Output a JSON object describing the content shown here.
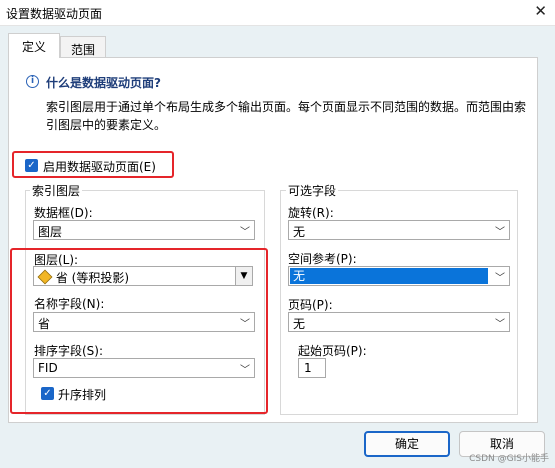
{
  "window": {
    "title": "设置数据驱动页面",
    "close_glyph": "✕"
  },
  "tabs": [
    {
      "label": "定义"
    },
    {
      "label": "范围"
    }
  ],
  "info": {
    "title": "什么是数据驱动页面?",
    "text": "索引图层用于通过单个布局生成多个输出页面。每个页面显示不同范围的数据。而范围由索引图层中的要素定义。"
  },
  "enable": {
    "label": "启用数据驱动页面(E)",
    "checked": true
  },
  "index_group": {
    "title": "索引图层",
    "frame": {
      "label": "数据框(D):",
      "value": "图层"
    },
    "layer": {
      "label": "图层(L):",
      "value": "省 (等积投影)"
    },
    "name_field": {
      "label": "名称字段(N):",
      "value": "省"
    },
    "sort_field": {
      "label": "排序字段(S):",
      "value": "FID"
    },
    "ascending": {
      "label": "升序排列",
      "checked": true
    }
  },
  "optional_group": {
    "title": "可选字段",
    "rotation": {
      "label": "旋转(R):",
      "value": "无"
    },
    "spatial_ref": {
      "label": "空间参考(P):",
      "value": "无"
    },
    "page_number": {
      "label": "页码(P):",
      "value": "无"
    },
    "start_page": {
      "label": "起始页码(P):",
      "value": "1"
    }
  },
  "buttons": {
    "ok": "确定",
    "cancel": "取消"
  },
  "watermark": "CSDN @GIS小能手",
  "colors": {
    "accent": "#1a66c8",
    "highlight_box": "#e5252a",
    "selection": "#0a74da"
  }
}
